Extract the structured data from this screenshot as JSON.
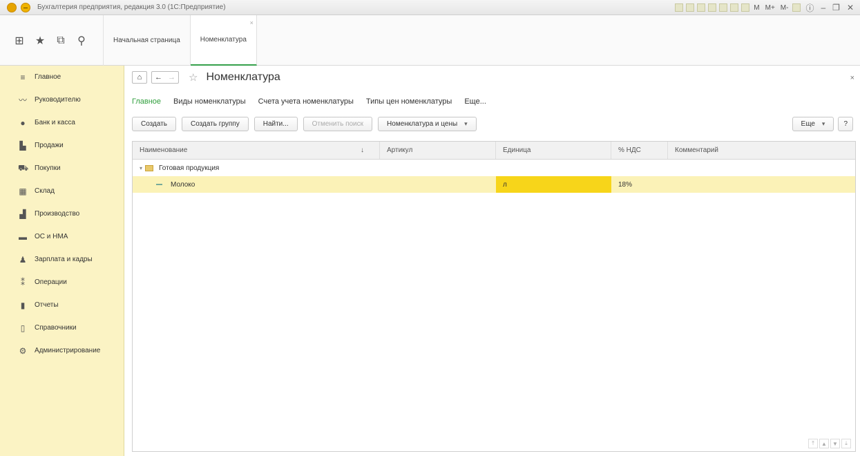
{
  "window": {
    "title": "Бухгалтерия предприятия, редакция 3.0 (1С:Предприятие)",
    "tools_text": [
      "M",
      "M+",
      "M-"
    ]
  },
  "tabs": [
    {
      "label": "Начальная страница",
      "active": false
    },
    {
      "label": "Номенклатура",
      "active": true
    }
  ],
  "sidebar": {
    "items": [
      {
        "label": "Главное",
        "icon": "menu-icon"
      },
      {
        "label": "Руководителю",
        "icon": "trend-icon"
      },
      {
        "label": "Банк и касса",
        "icon": "coins-icon"
      },
      {
        "label": "Продажи",
        "icon": "shop-icon"
      },
      {
        "label": "Покупки",
        "icon": "cart-icon"
      },
      {
        "label": "Склад",
        "icon": "warehouse-icon"
      },
      {
        "label": "Производство",
        "icon": "factory-icon"
      },
      {
        "label": "ОС и НМА",
        "icon": "truck-icon"
      },
      {
        "label": "Зарплата и кадры",
        "icon": "person-icon"
      },
      {
        "label": "Операции",
        "icon": "operations-icon"
      },
      {
        "label": "Отчеты",
        "icon": "report-icon"
      },
      {
        "label": "Справочники",
        "icon": "book-icon"
      },
      {
        "label": "Администрирование",
        "icon": "gear-icon"
      }
    ]
  },
  "form": {
    "title": "Номенклатура",
    "subtabs": [
      "Главное",
      "Виды номенклатуры",
      "Счета учета номенклатуры",
      "Типы цен номенклатуры",
      "Еще..."
    ],
    "commands": {
      "create": "Создать",
      "create_group": "Создать группу",
      "find": "Найти...",
      "cancel_search": "Отменить поиск",
      "prices": "Номенклатура и цены",
      "more": "Еще",
      "help": "?"
    },
    "columns": [
      "Наименование",
      "Артикул",
      "Единица",
      "% НДС",
      "Комментарий"
    ],
    "sort_indicator": "↓",
    "rows": [
      {
        "type": "group",
        "name": "Готовая продукция",
        "article": "",
        "unit": "",
        "vat": "",
        "comment": ""
      },
      {
        "type": "item",
        "name": "Молоко",
        "article": "",
        "unit": "л",
        "vat": "18%",
        "comment": ""
      }
    ]
  },
  "colors": {
    "accent_green": "#2f9e3c",
    "sidebar_bg": "#fbf3c4",
    "selected_row": "#fbf2b7",
    "current_cell": "#f7d51a"
  }
}
